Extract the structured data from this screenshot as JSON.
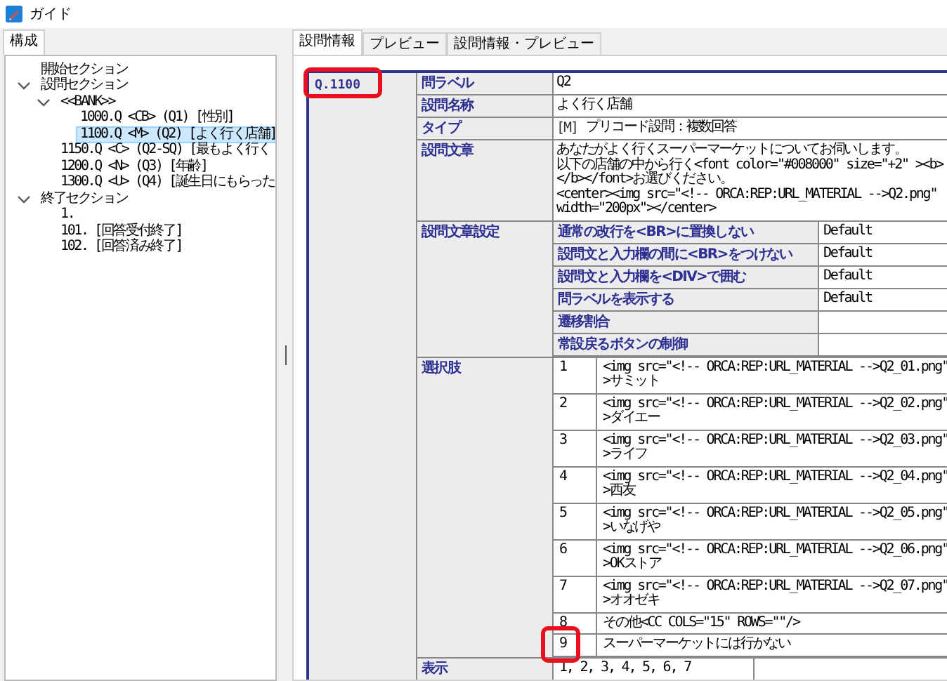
{
  "window": {
    "title": "ガイド"
  },
  "left_panel": {
    "tabs": [
      {
        "label": "構成",
        "selected": true
      }
    ],
    "tree": [
      {
        "label": "開始セクション",
        "selected": false
      },
      {
        "label": "設問セクション",
        "expanded": true,
        "selected": false,
        "children": [
          {
            "label": "<<BANK>>",
            "expanded": true,
            "selected": false,
            "children": [
              {
                "label": "1000.Q <CB> (Q1) [性別]",
                "selected": false
              },
              {
                "label": "1100.Q <M> (Q2) [よく行く店舗]",
                "selected": true
              }
            ]
          },
          {
            "label": "1150.Q <C> (Q2-SQ) [最もよく行く",
            "selected": false
          },
          {
            "label": "1200.Q <N> (Q3) [年齢]",
            "selected": false
          },
          {
            "label": "1300.Q <U> (Q4) [誕生日にもらった",
            "selected": false
          }
        ]
      },
      {
        "label": "終了セクション",
        "expanded": true,
        "selected": false,
        "children": [
          {
            "label": "1.",
            "selected": false
          },
          {
            "label": "101. [回答受付終了]",
            "selected": false
          },
          {
            "label": "102. [回答済み終了]",
            "selected": false
          }
        ]
      }
    ]
  },
  "tabs": [
    {
      "label": "設問情報",
      "selected": true
    },
    {
      "label": "プレビュー",
      "selected": false
    },
    {
      "label": "設問情報・プレビュー",
      "selected": false
    }
  ],
  "question": {
    "id": "Q.1100",
    "highlighted": true,
    "fields": [
      {
        "kind": "text",
        "label": "問ラベル",
        "lines": [
          "Q2"
        ]
      },
      {
        "kind": "text",
        "label": "設問名称",
        "lines": [
          "よく行く店舗"
        ]
      },
      {
        "kind": "type",
        "label": "タイプ",
        "tag": "[M]",
        "value": "プリコード設問：複数回答"
      },
      {
        "kind": "text",
        "label": "設問文章",
        "lines": [
          "あなたがよく行くスーパーマーケットについてお伺いします。",
          "以下の店舗の中から行く<font color=\"#008000\" size=\"+2\" ><b>",
          "</b></font>お選びください。",
          "<center><img src=\"<!-- ORCA:REP:URL_MATERIAL -->Q2.png\"",
          "width=\"200px\"></center>"
        ]
      },
      {
        "kind": "settings",
        "label": "設問文章設定",
        "rows": [
          {
            "label": "通常の改行を<BR>に置換しない",
            "value": "Default"
          },
          {
            "label": "設問文と入力欄の間に<BR>をつけない",
            "value": "Default"
          },
          {
            "label": "設問文と入力欄を<DIV>で囲む",
            "value": "Default"
          },
          {
            "label": "問ラベルを表示する",
            "value": "Default"
          },
          {
            "label": "遷移割合"
          },
          {
            "label": "常設戻るボタンの制御"
          }
        ]
      },
      {
        "kind": "choices",
        "label": "選択肢",
        "rows": [
          {
            "number": "1",
            "lines": [
              "<img src=\"<!-- ORCA:REP:URL_MATERIAL -->Q2_01.png\"",
              ">サミット"
            ],
            "highlighted": false
          },
          {
            "number": "2",
            "lines": [
              "<img src=\"<!-- ORCA:REP:URL_MATERIAL -->Q2_02.png\"",
              ">ダイエー"
            ],
            "highlighted": false
          },
          {
            "number": "3",
            "lines": [
              "<img src=\"<!-- ORCA:REP:URL_MATERIAL -->Q2_03.png\"",
              ">ライフ"
            ],
            "highlighted": false
          },
          {
            "number": "4",
            "lines": [
              "<img src=\"<!-- ORCA:REP:URL_MATERIAL -->Q2_04.png\"",
              ">西友"
            ],
            "highlighted": false
          },
          {
            "number": "5",
            "lines": [
              "<img src=\"<!-- ORCA:REP:URL_MATERIAL -->Q2_05.png\"",
              ">いなげや"
            ],
            "highlighted": false
          },
          {
            "number": "6",
            "lines": [
              "<img src=\"<!-- ORCA:REP:URL_MATERIAL -->Q2_06.png\"",
              ">OKストア"
            ],
            "highlighted": false
          },
          {
            "number": "7",
            "lines": [
              "<img src=\"<!-- ORCA:REP:URL_MATERIAL -->Q2_07.png\"",
              ">オオゼキ"
            ],
            "highlighted": false
          },
          {
            "number": "8",
            "lines": [
              "その他<CC COLS=\"15\" ROWS=\"\"/>"
            ],
            "highlighted": false
          },
          {
            "number": "9",
            "lines": [
              "スーパーマーケットには行かない"
            ],
            "highlighted": true
          }
        ]
      },
      {
        "kind": "display",
        "label": "表示",
        "value": "1, 2, 3, 4, 5, 6, 7"
      }
    ]
  }
}
